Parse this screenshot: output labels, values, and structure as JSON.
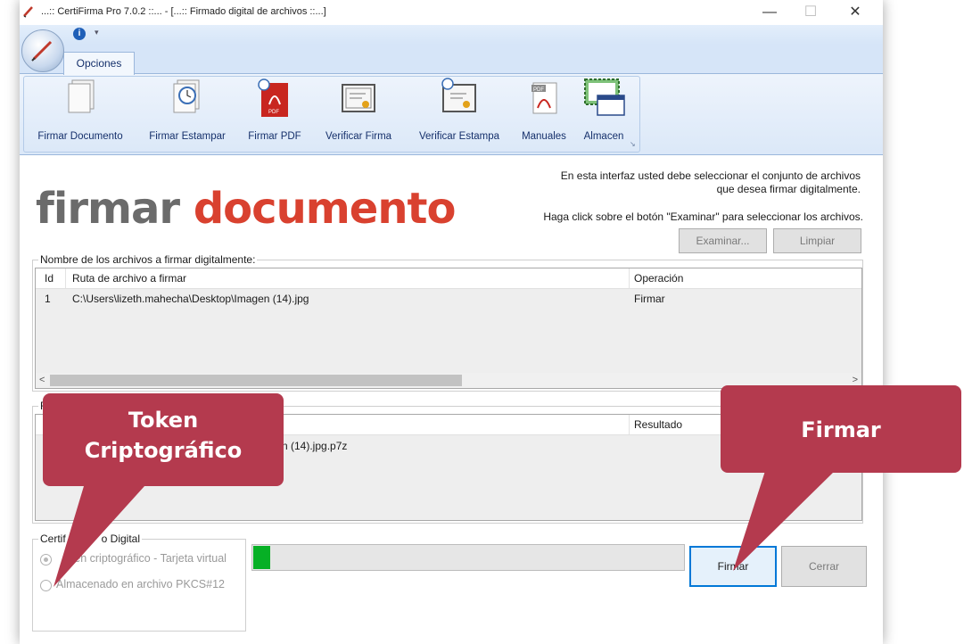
{
  "window": {
    "title": "...:: CertiFirma Pro 7.0.2 ::... - [...:: Firmado digital de archivos ::...]",
    "minimize": "—",
    "maximize": "☐",
    "close": "✕"
  },
  "quick_access": {
    "info_icon": "i",
    "dropdown": "▾"
  },
  "ribbon": {
    "tab": "Opciones",
    "buttons": [
      {
        "label": "Firmar Documento",
        "icon": "document-icon"
      },
      {
        "label": "Firmar Estampar",
        "icon": "document-clock-icon"
      },
      {
        "label": "Firmar PDF",
        "icon": "pdf-clock-icon"
      },
      {
        "label": "Verificar Firma",
        "icon": "certificate-icon"
      },
      {
        "label": "Verificar Estampa",
        "icon": "certificate-clock-icon"
      },
      {
        "label": "Manuales",
        "icon": "pdf-icon"
      },
      {
        "label": "Almacen",
        "icon": "certificate-window-icon"
      }
    ]
  },
  "header": {
    "title_word1": "firmar",
    "title_word2": "documento",
    "info_line1": "En esta interfaz usted debe seleccionar el conjunto de archivos",
    "info_line2": "que  desea firmar digitalmente.",
    "info_line3": "Haga click sobre el botón \"Examinar\" para seleccionar los archivos."
  },
  "actions": {
    "examinar": "Examinar...",
    "limpiar": "Limpiar"
  },
  "files_table": {
    "legend": "Nombre de los archivos a firmar digitalmente:",
    "columns": [
      "Id",
      "Ruta de archivo a firmar",
      "Operación"
    ],
    "rows": [
      {
        "id": "1",
        "path": "C:\\Users\\lizeth.mahecha\\Desktop\\Imagen (14).jpg",
        "operation": "Firmar"
      }
    ],
    "scroll_left": "<",
    "scroll_right": ">"
  },
  "results_table": {
    "legend_visible": "R",
    "column_first_visible": "I",
    "column_result": "Resultado",
    "row_path_visible": "n (14).jpg.p7z"
  },
  "certificate": {
    "legend_start": "Certif",
    "legend_end": "o Digital",
    "option_token": "Token criptográfico - Tarjeta virtual",
    "option_token_visible": "ken criptográfico - Tarjeta virtual",
    "option_file": "Almacenado en archivo PKCS#12",
    "selected": "token"
  },
  "progress": {
    "value_percent": 4
  },
  "buttons": {
    "firmar": "Firmar",
    "cerrar": "Cerrar"
  },
  "callouts": {
    "token_line1": "Token",
    "token_line2": "Criptográfico",
    "firmar": "Firmar",
    "color": "#b43a4e"
  }
}
